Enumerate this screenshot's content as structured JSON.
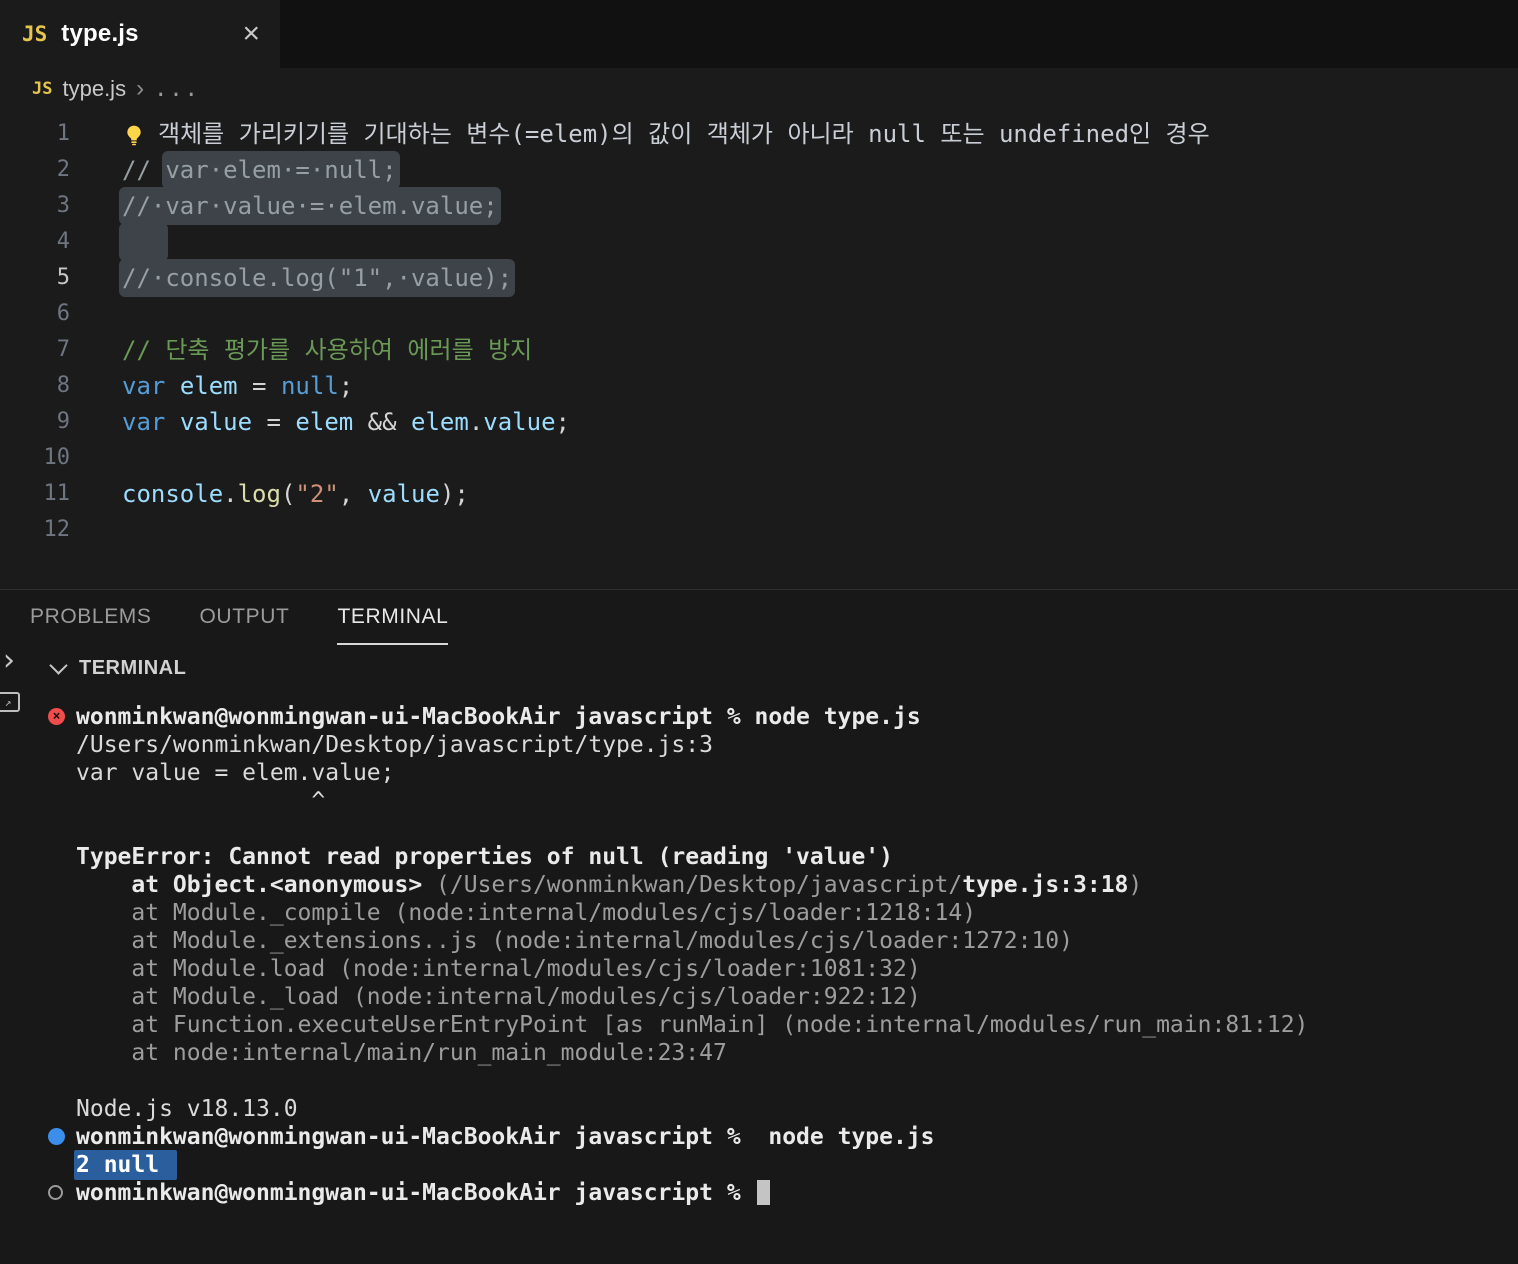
{
  "colors": {
    "js-icon": "#e3c64b",
    "kw": "#569cd6",
    "vr": "#9cdcfe",
    "fn": "#dcdcaa",
    "str": "#ce9178",
    "cmt": "#6a9955",
    "cmt2": "#96a0a2",
    "fg": "#d4d4d4",
    "line1": "#c9ced6",
    "selbg": "#3e4349",
    "err": "#f14c4c",
    "dblue": "#3b8eea",
    "tsel": "#2a5e9c"
  },
  "tabbar": {
    "js_icon_label": "JS",
    "tab_label": "type.js",
    "close_glyph": "×"
  },
  "breadcrumb": {
    "icon_label": "JS",
    "file": "type.js",
    "separator": "›",
    "tail": "..."
  },
  "editor": {
    "lines": [
      {
        "num": "1",
        "lightbulb": true,
        "segments": [
          {
            "t": "객체를 가리키기를 기대하는 변수(=elem)의 값이 객체가 아니라 null 또는 undefined인 경우",
            "c": "fg1"
          }
        ]
      },
      {
        "num": "2",
        "segments": [
          {
            "t": "// ",
            "c": "cmt2"
          },
          {
            "t": "var·elem·=·null;",
            "c": "cmt2",
            "sel": true
          }
        ]
      },
      {
        "num": "3",
        "segments": [
          {
            "t": "//·var·value·=·elem.value;",
            "c": "cmt2",
            "sel": true
          }
        ]
      },
      {
        "num": "4",
        "segments": [
          {
            "t": "   ",
            "c": "cmt2",
            "sel": true
          }
        ]
      },
      {
        "num": "5",
        "active": true,
        "segments": [
          {
            "t": "//·console.log(\"1\",·value);",
            "c": "cmt2",
            "sel": true
          }
        ]
      },
      {
        "num": "6",
        "segments": []
      },
      {
        "num": "7",
        "segments": [
          {
            "t": "// 단축 평가를 사용하여 에러를 방지",
            "c": "cmt"
          }
        ]
      },
      {
        "num": "8",
        "segments": [
          {
            "t": "var",
            "c": "kw"
          },
          {
            "t": " ",
            "c": "fg"
          },
          {
            "t": "elem",
            "c": "var"
          },
          {
            "t": " = ",
            "c": "fg"
          },
          {
            "t": "null",
            "c": "kw"
          },
          {
            "t": ";",
            "c": "fg"
          }
        ]
      },
      {
        "num": "9",
        "segments": [
          {
            "t": "var",
            "c": "kw"
          },
          {
            "t": " ",
            "c": "fg"
          },
          {
            "t": "value",
            "c": "var"
          },
          {
            "t": " = ",
            "c": "fg"
          },
          {
            "t": "elem",
            "c": "var"
          },
          {
            "t": " && ",
            "c": "fg"
          },
          {
            "t": "elem",
            "c": "var"
          },
          {
            "t": ".",
            "c": "fg"
          },
          {
            "t": "value",
            "c": "var"
          },
          {
            "t": ";",
            "c": "fg"
          }
        ]
      },
      {
        "num": "10",
        "segments": []
      },
      {
        "num": "11",
        "segments": [
          {
            "t": "console",
            "c": "var"
          },
          {
            "t": ".",
            "c": "fg"
          },
          {
            "t": "log",
            "c": "fn"
          },
          {
            "t": "(",
            "c": "fg"
          },
          {
            "t": "\"2\"",
            "c": "str"
          },
          {
            "t": ", ",
            "c": "fg"
          },
          {
            "t": "value",
            "c": "var"
          },
          {
            "t": ")",
            "c": "fg"
          },
          {
            "t": ";",
            "c": "fg"
          }
        ]
      },
      {
        "num": "12",
        "segments": []
      }
    ]
  },
  "panel": {
    "tabs": [
      {
        "label": "PROBLEMS",
        "active": false
      },
      {
        "label": "OUTPUT",
        "active": false
      },
      {
        "label": "TERMINAL",
        "active": true
      }
    ],
    "section_label": "TERMINAL"
  },
  "side_rail": {
    "chevron": "›",
    "box_glyph": "↗"
  },
  "terminal": {
    "lines": [
      {
        "icon": "error",
        "segments": [
          {
            "t": "wonminkwan@wonmingwan-ui-MacBookAir javascript % node type.js",
            "c": "bright"
          }
        ]
      },
      {
        "segments": [
          {
            "t": "/Users/wonminkwan/Desktop/javascript/type.js:3",
            "c": "norm"
          }
        ]
      },
      {
        "segments": [
          {
            "t": "var value = elem.value;",
            "c": "norm"
          }
        ]
      },
      {
        "segments": [
          {
            "t": "                 ^",
            "c": "norm"
          }
        ]
      },
      {
        "segments": []
      },
      {
        "segments": [
          {
            "t": "TypeError: Cannot read properties of null (reading 'value')",
            "c": "bright"
          }
        ]
      },
      {
        "segments": [
          {
            "t": "    at Object.<anonymous> ",
            "c": "bright"
          },
          {
            "t": "(/Users/wonminkwan/Desktop/javascript/",
            "c": "dim"
          },
          {
            "t": "type.js:3:18",
            "c": "bright"
          },
          {
            "t": ")",
            "c": "dim"
          }
        ]
      },
      {
        "segments": [
          {
            "t": "    at Module._compile (node:internal/modules/cjs/loader:1218:14)",
            "c": "dim"
          }
        ]
      },
      {
        "segments": [
          {
            "t": "    at Module._extensions..js (node:internal/modules/cjs/loader:1272:10)",
            "c": "dim"
          }
        ]
      },
      {
        "segments": [
          {
            "t": "    at Module.load (node:internal/modules/cjs/loader:1081:32)",
            "c": "dim"
          }
        ]
      },
      {
        "segments": [
          {
            "t": "    at Module._load (node:internal/modules/cjs/loader:922:12)",
            "c": "dim"
          }
        ]
      },
      {
        "segments": [
          {
            "t": "    at Function.executeUserEntryPoint [as runMain] (node:internal/modules/run_main:81:12)",
            "c": "dim"
          }
        ]
      },
      {
        "segments": [
          {
            "t": "    at node:internal/main/run_main_module:23:47",
            "c": "dim"
          }
        ]
      },
      {
        "segments": []
      },
      {
        "segments": [
          {
            "t": "Node.js v18.13.0",
            "c": "norm"
          }
        ]
      },
      {
        "icon": "success",
        "segments": [
          {
            "t": "wonminkwan@wonmingwan-ui-MacBookAir javascript %  node type.js",
            "c": "bright"
          }
        ]
      },
      {
        "segments": [
          {
            "t": "2 null",
            "c": "bright",
            "sel": true
          }
        ]
      },
      {
        "icon": "idle",
        "cursor": true,
        "segments": [
          {
            "t": "wonminkwan@wonmingwan-ui-MacBookAir javascript % ",
            "c": "bright"
          }
        ]
      }
    ]
  }
}
